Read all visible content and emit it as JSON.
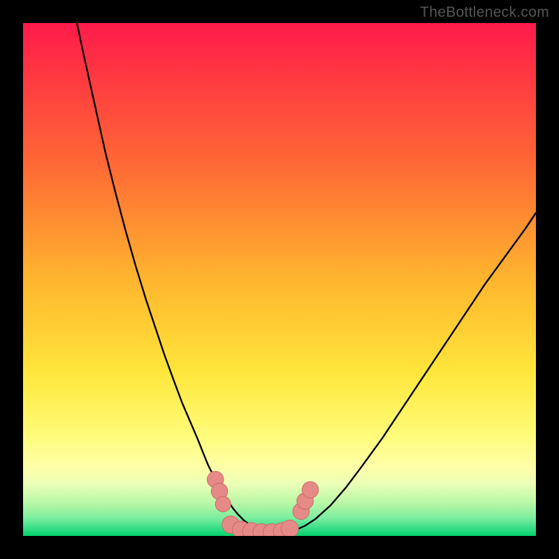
{
  "watermark": "TheBottleneck.com",
  "colors": {
    "top": "#ff1b4a",
    "mid_orange": "#ff8a30",
    "yellow": "#ffe63b",
    "pale_yellow": "#ffff9b",
    "pale_green": "#d3ffb0",
    "green_band": "#52e08a",
    "deep_green": "#00d36a",
    "curve": "#000000",
    "marker_fill": "#e68a88",
    "marker_stroke": "#cc6b68",
    "frame": "#000000"
  },
  "chart_data": {
    "type": "line",
    "title": "",
    "xlabel": "",
    "ylabel": "",
    "xlim": [
      0,
      100
    ],
    "ylim": [
      0,
      100
    ],
    "grid": false,
    "legend": false,
    "curve_comment": "x,y pairs in plot coordinates (0-100 each); y=0 is bottom, y=100 is top. Two-branch V-shaped bottleneck curve.",
    "series": [
      {
        "name": "bottleneck-curve",
        "x": [
          10.5,
          12,
          14,
          16,
          18,
          20,
          22,
          24,
          26,
          27.5,
          29.5,
          31,
          32.5,
          34,
          35,
          36,
          37,
          38,
          39,
          40,
          41,
          42,
          43,
          44,
          45,
          47,
          49,
          51,
          53,
          55,
          57,
          60,
          63,
          66,
          70,
          74,
          78,
          82,
          86,
          90,
          94,
          98,
          100
        ],
        "y": [
          100,
          93,
          84,
          75,
          67,
          59.5,
          52.5,
          46,
          40,
          35.5,
          30,
          26,
          22.5,
          19,
          16.5,
          14,
          12,
          10,
          8.2,
          6.7,
          5.3,
          4.1,
          3.1,
          2.3,
          1.7,
          0.9,
          0.5,
          0.6,
          1.1,
          2,
          3.3,
          6,
          9.5,
          13.5,
          19,
          25,
          31,
          37,
          43,
          49,
          54.5,
          60,
          63
        ]
      }
    ],
    "markers": {
      "comment": "Pink bead markers near the valley of the curve.",
      "points": [
        {
          "x": 37.5,
          "y": 11.0,
          "r": 1.6
        },
        {
          "x": 38.3,
          "y": 8.7,
          "r": 1.6
        },
        {
          "x": 39.0,
          "y": 6.2,
          "r": 1.5
        },
        {
          "x": 40.5,
          "y": 2.2,
          "r": 1.7
        },
        {
          "x": 42.5,
          "y": 1.2,
          "r": 1.7
        },
        {
          "x": 44.5,
          "y": 0.9,
          "r": 1.7
        },
        {
          "x": 46.5,
          "y": 0.7,
          "r": 1.7
        },
        {
          "x": 48.5,
          "y": 0.7,
          "r": 1.7
        },
        {
          "x": 50.5,
          "y": 0.9,
          "r": 1.7
        },
        {
          "x": 52.0,
          "y": 1.4,
          "r": 1.7
        },
        {
          "x": 54.2,
          "y": 4.8,
          "r": 1.6
        },
        {
          "x": 55.0,
          "y": 6.8,
          "r": 1.6
        },
        {
          "x": 56.0,
          "y": 9.0,
          "r": 1.6
        }
      ]
    },
    "background_gradient_stops": [
      {
        "pos": 0.0,
        "color": "#ff1b4a"
      },
      {
        "pos": 0.28,
        "color": "#ff6a35"
      },
      {
        "pos": 0.5,
        "color": "#ffb52e"
      },
      {
        "pos": 0.68,
        "color": "#ffe63b"
      },
      {
        "pos": 0.8,
        "color": "#fffb77"
      },
      {
        "pos": 0.865,
        "color": "#ffffa8"
      },
      {
        "pos": 0.9,
        "color": "#eaffb7"
      },
      {
        "pos": 0.935,
        "color": "#b9f7a6"
      },
      {
        "pos": 0.965,
        "color": "#7ceea0"
      },
      {
        "pos": 0.985,
        "color": "#38dd88"
      },
      {
        "pos": 1.0,
        "color": "#00d36a"
      }
    ]
  }
}
